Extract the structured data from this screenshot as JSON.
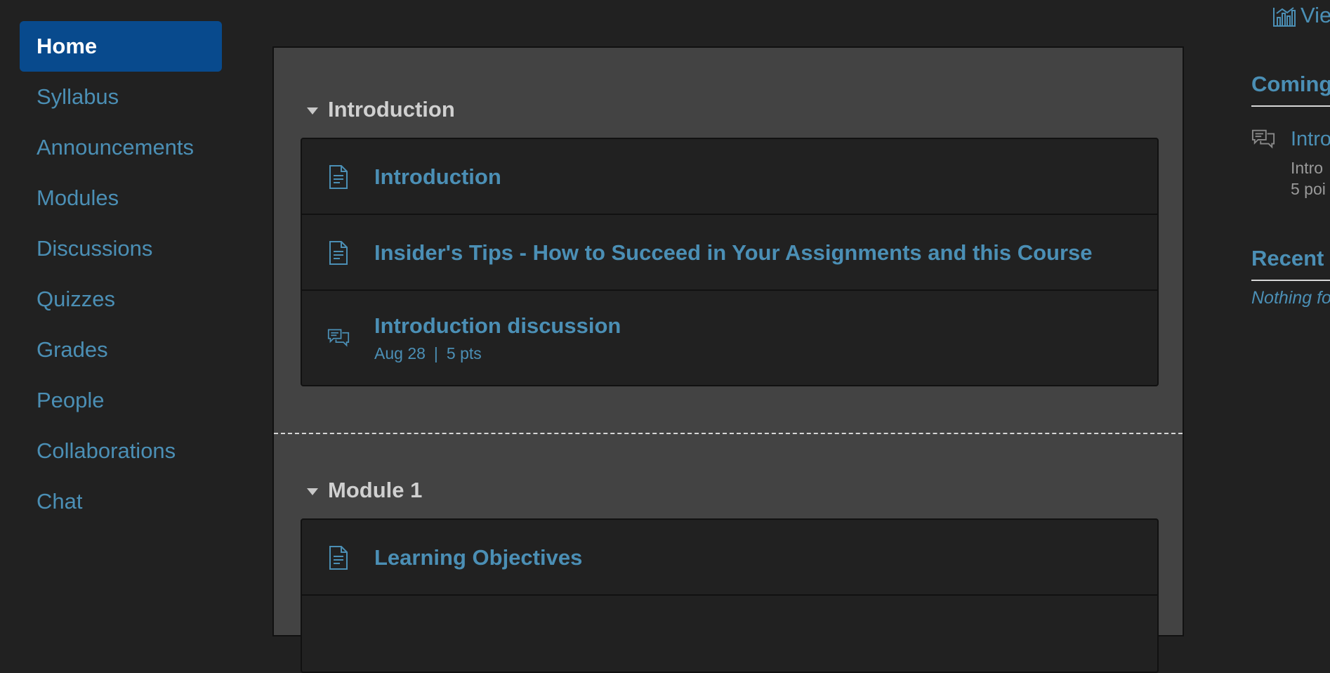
{
  "course_nav": {
    "items": [
      {
        "label": "Home",
        "active": true
      },
      {
        "label": "Syllabus"
      },
      {
        "label": "Announcements"
      },
      {
        "label": "Modules"
      },
      {
        "label": "Discussions"
      },
      {
        "label": "Quizzes"
      },
      {
        "label": "Grades"
      },
      {
        "label": "People"
      },
      {
        "label": "Collaborations"
      },
      {
        "label": "Chat"
      }
    ]
  },
  "modules": [
    {
      "title": "Introduction",
      "items": [
        {
          "icon": "page-icon",
          "title": "Introduction"
        },
        {
          "icon": "page-icon",
          "title": "Insider's Tips - How to Succeed in Your Assignments and this Course"
        },
        {
          "icon": "discussion-icon",
          "title": "Introduction discussion",
          "date": "Aug 28",
          "separator": "|",
          "points": "5 pts"
        }
      ]
    },
    {
      "title": "Module 1",
      "items": [
        {
          "icon": "page-icon",
          "title": "Learning Objectives"
        }
      ]
    }
  ],
  "sidebar": {
    "view_link": "Vie",
    "coming_heading": "Coming",
    "todo": {
      "icon": "discussion-icon",
      "title": "Intro",
      "line1": "Intro",
      "line2": "5 poi"
    },
    "recent_heading": "Recent I",
    "recent_empty": "Nothing fo"
  },
  "colors": {
    "accent": "#4b8fb5",
    "active_nav": "#084a8d",
    "background": "#212121",
    "module_panel": "#434343"
  }
}
